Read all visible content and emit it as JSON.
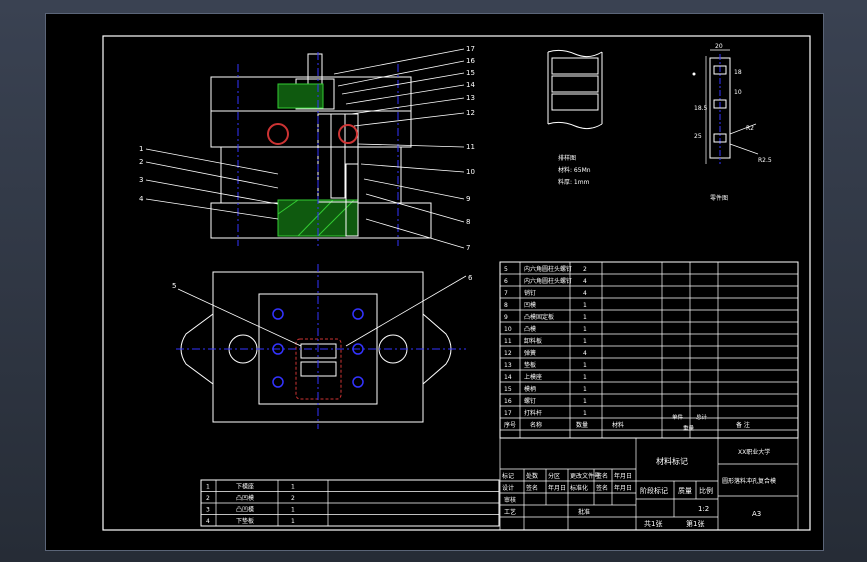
{
  "balloons": {
    "right": [
      "17",
      "16",
      "15",
      "14",
      "13",
      "12",
      "11",
      "10",
      "9",
      "8",
      "7"
    ],
    "left": [
      "1",
      "2",
      "3",
      "4"
    ],
    "plan_left": "5",
    "plan_right": "6"
  },
  "strip_notes": [
    "排样图",
    "材料: 65Mn",
    "料厚: 1mm"
  ],
  "part": {
    "dims": [
      "20",
      "18",
      "10",
      "18.5",
      "25",
      "R2",
      "R2.5"
    ],
    "caption": "零件图"
  },
  "bom": {
    "rows": [
      {
        "no": "5",
        "name": "内六角圆柱头螺钉",
        "qty": "2"
      },
      {
        "no": "6",
        "name": "内六角圆柱头螺钉",
        "qty": "4"
      },
      {
        "no": "7",
        "name": "销钉",
        "qty": "4"
      },
      {
        "no": "8",
        "name": "凹模",
        "qty": "1"
      },
      {
        "no": "9",
        "name": "凸模固定板",
        "qty": "1"
      },
      {
        "no": "10",
        "name": "凸模",
        "qty": "1"
      },
      {
        "no": "11",
        "name": "卸料板",
        "qty": "1"
      },
      {
        "no": "12",
        "name": "弹簧",
        "qty": "4"
      },
      {
        "no": "13",
        "name": "垫板",
        "qty": "1"
      },
      {
        "no": "14",
        "name": "上模座",
        "qty": "1"
      },
      {
        "no": "15",
        "name": "模柄",
        "qty": "1"
      },
      {
        "no": "16",
        "name": "螺钉",
        "qty": "1"
      },
      {
        "no": "17",
        "name": "打料杆",
        "qty": "1"
      }
    ],
    "headers": {
      "no": "序号",
      "name": "名称",
      "qty": "数量",
      "material": "材料",
      "unit": "单件",
      "total": "总计",
      "weight": "重量",
      "remark": "备 注"
    }
  },
  "title_block": {
    "material_mark": "材料标记",
    "company": "XX职业大学",
    "drawing_name": "圆形落料冲孔复合模",
    "sheet_size": "A3",
    "stage_mark": "阶段标记",
    "mass": "质量",
    "scale_label": "比例",
    "scale_value": "1:2",
    "total_sheets": "共1张",
    "sheet_no": "第1张",
    "row1": [
      "标记",
      "处数",
      "分区",
      "更改文件号",
      "签名",
      "年月日"
    ],
    "row2": [
      "设计",
      "签名",
      "年月日",
      "标准化",
      "签名",
      "年月日"
    ],
    "reviewer": "审核",
    "process": "工艺",
    "approve": "批准"
  },
  "small_bom": {
    "rows": [
      {
        "no": "1",
        "name": "下模座",
        "qty": "1"
      },
      {
        "no": "2",
        "name": "凸凹模",
        "qty": "2"
      },
      {
        "no": "3",
        "name": "凸凹模",
        "qty": "1"
      },
      {
        "no": "4",
        "name": "下垫板",
        "qty": "1"
      }
    ]
  },
  "colors": {
    "background": "#000000",
    "line": "#ffffff",
    "center": "#3333ff",
    "hatch": "#33cc33",
    "cut": "#cc3333"
  }
}
